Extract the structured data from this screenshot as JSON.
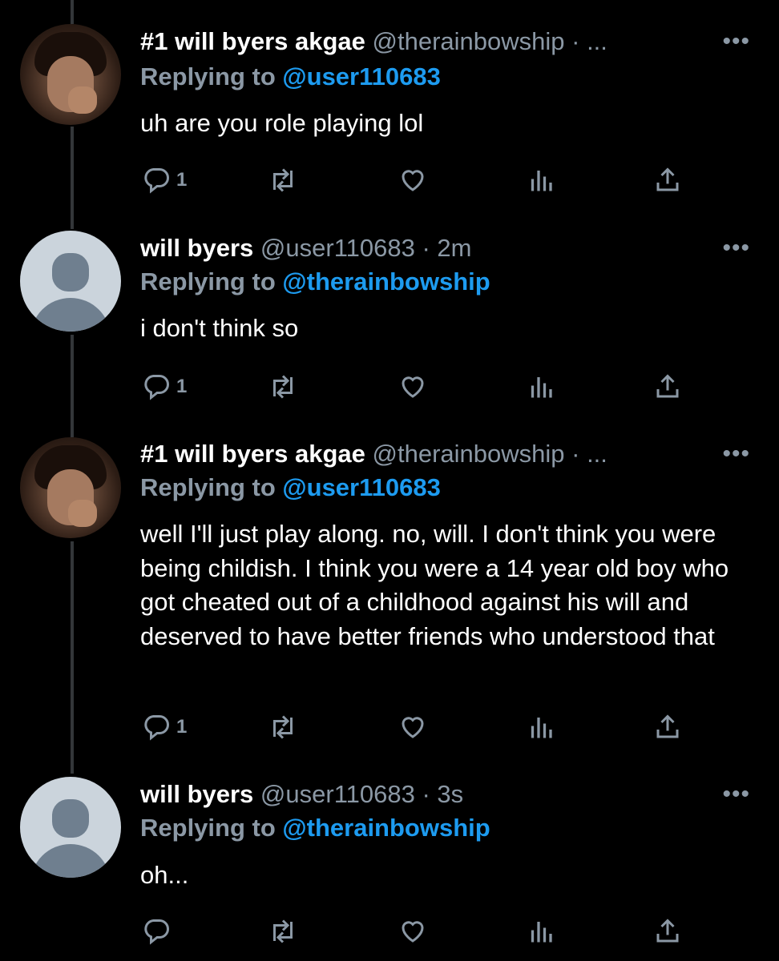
{
  "tweets": [
    {
      "name": "#1 will byers akgae",
      "handle": "@therainbowship · ...",
      "replying_prefix": "Replying to",
      "replying_to": "@user110683",
      "text": "uh are you role playing lol",
      "reply_count": "1",
      "avatar": "photo"
    },
    {
      "name": "will byers",
      "handle": "@user110683 · 2m",
      "replying_prefix": "Replying to",
      "replying_to": "@therainbowship",
      "text": "i don't think so",
      "reply_count": "1",
      "avatar": "default"
    },
    {
      "name": "#1 will byers akgae",
      "handle": "@therainbowship · ...",
      "replying_prefix": "Replying to",
      "replying_to": "@user110683",
      "text": "well I'll just play along. no, will. I don't think you were being childish. I think you were a 14 year old boy who got cheated out of a childhood against his will and deserved to have better friends who understood that",
      "reply_count": "1",
      "avatar": "photo"
    },
    {
      "name": "will byers",
      "handle": "@user110683 · 3s",
      "replying_prefix": "Replying to",
      "replying_to": "@therainbowship",
      "text": "oh...",
      "reply_count": "",
      "avatar": "default"
    }
  ],
  "ui": {
    "more_label": "•••",
    "icons": [
      "reply-icon",
      "retweet-icon",
      "like-icon",
      "analytics-icon",
      "share-icon"
    ],
    "colors": {
      "background": "#000000",
      "mention": "#1d9bf0",
      "secondary": "#8b98a5",
      "thread_line": "#333639"
    }
  }
}
